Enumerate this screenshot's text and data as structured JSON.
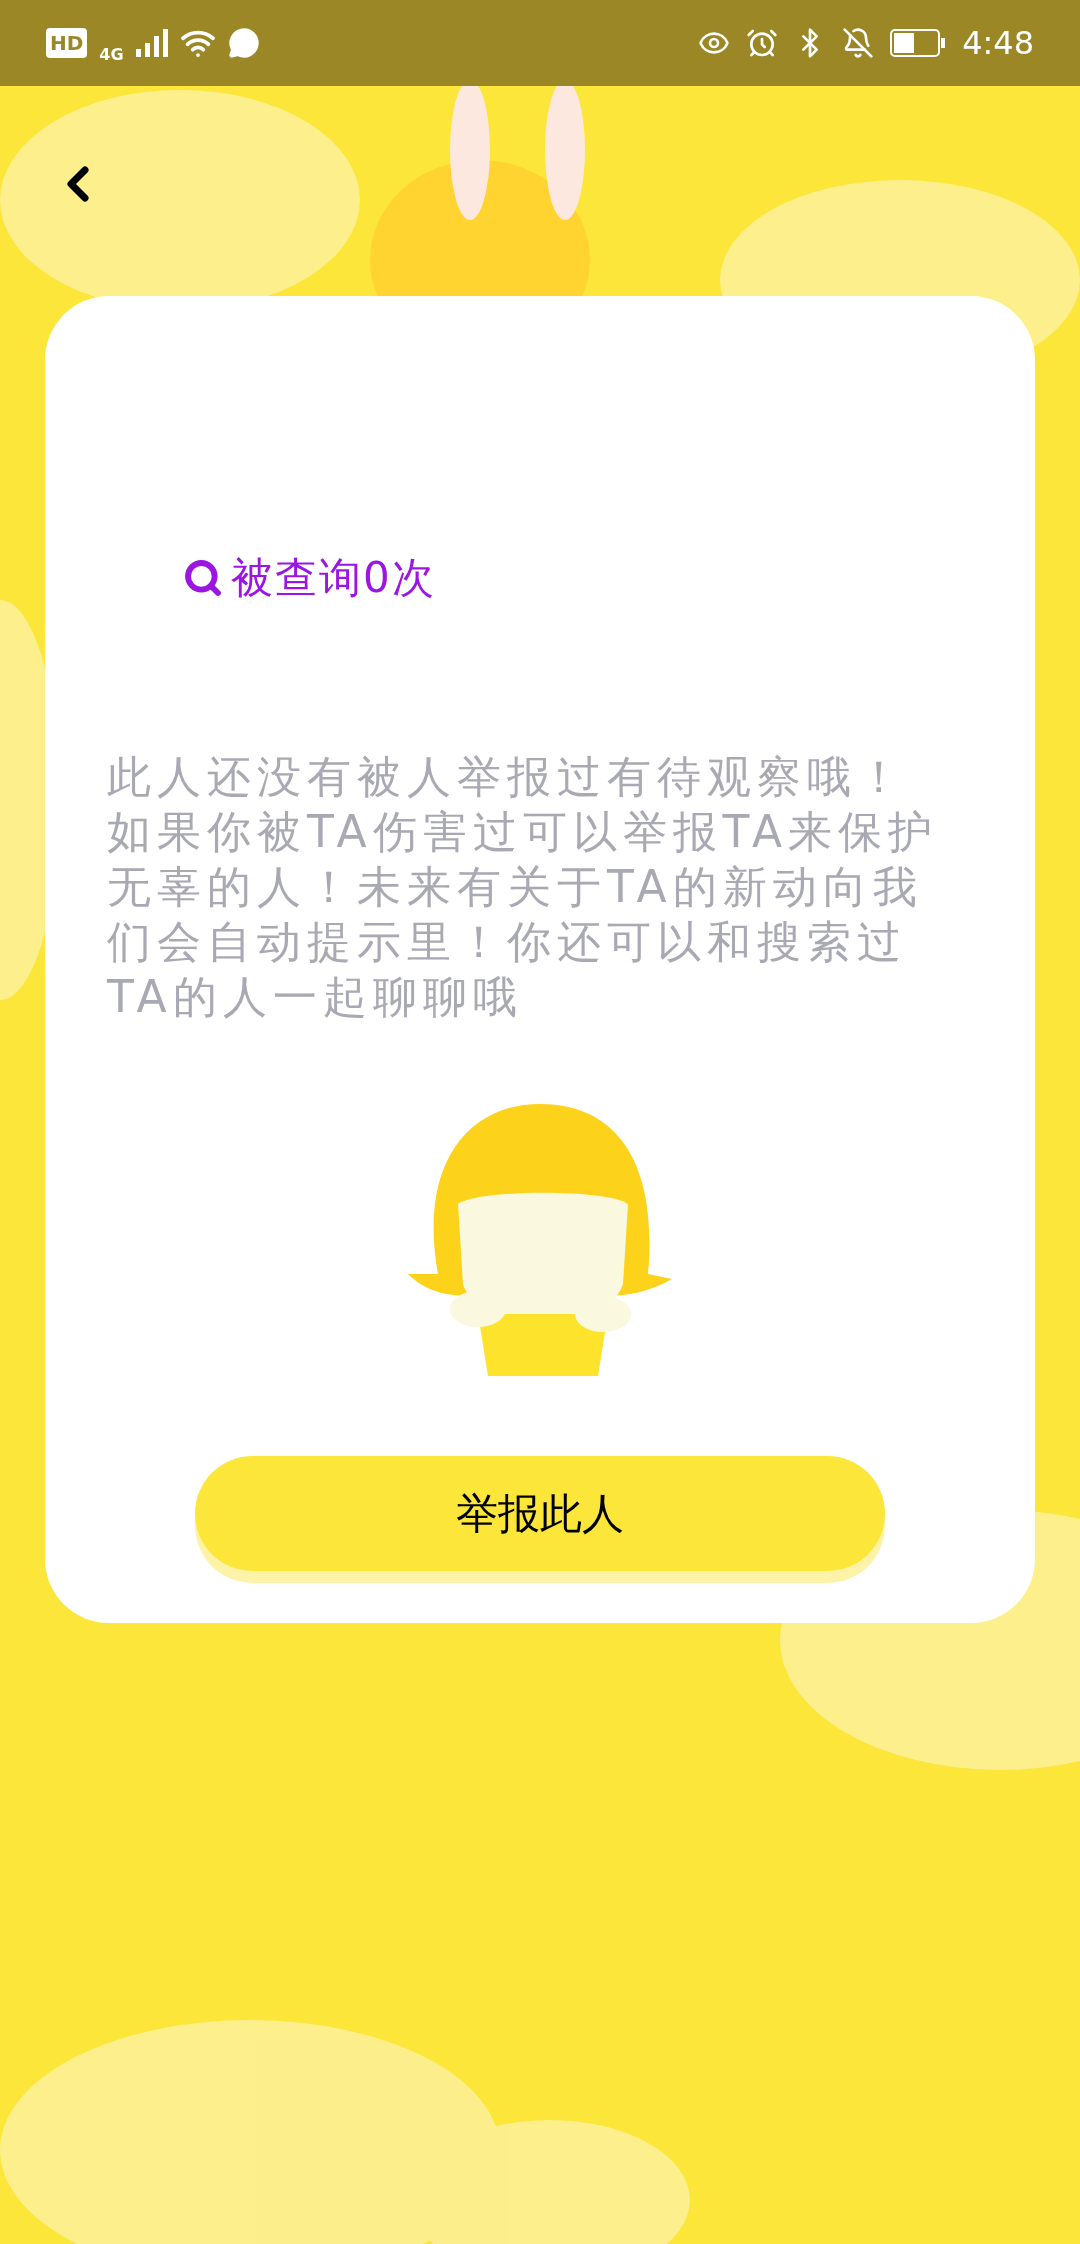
{
  "status_bar": {
    "hd": "HD",
    "network": "4G",
    "time": "4:48"
  },
  "query_count": "被查询0次",
  "message": "此人还没有被人举报过有待观察哦！如果你被TA伤害过可以举报TA来保护无辜的人！未来有关于TA的新动向我们会自动提示里！你还可以和搜索过TA的人一起聊聊哦",
  "report_button": "举报此人"
}
